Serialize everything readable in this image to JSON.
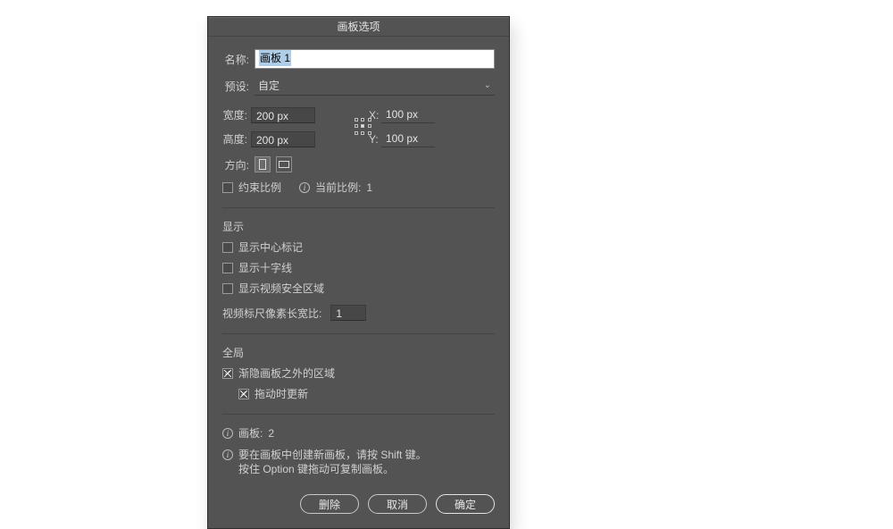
{
  "dialog": {
    "title": "画板选项",
    "name_label": "名称:",
    "name_value": "画板 1",
    "preset_label": "预设:",
    "preset_value": "自定",
    "width_label": "宽度:",
    "width_value": "200 px",
    "height_label": "高度:",
    "height_value": "200 px",
    "x_label": "X:",
    "x_value": "100 px",
    "y_label": "Y:",
    "y_value": "100 px",
    "orientation_label": "方向:",
    "constrain_label": "约束比例",
    "current_ratio_label": "当前比例:",
    "current_ratio_value": "1",
    "display_heading": "显示",
    "show_center_label": "显示中心标记",
    "show_crosshair_label": "显示十字线",
    "show_safe_label": "显示视频安全区域",
    "ruler_ratio_label": "视频标尺像素长宽比:",
    "ruler_ratio_value": "1",
    "global_heading": "全局",
    "fade_label": "渐隐画板之外的区域",
    "drag_update_label": "拖动时更新",
    "artboard_count_label": "画板:",
    "artboard_count_value": "2",
    "hint_line1": "要在画板中创建新画板，请按 Shift 键。",
    "hint_line2": "按住 Option 键拖动可复制画板。",
    "buttons": {
      "delete": "删除",
      "cancel": "取消",
      "ok": "确定"
    }
  }
}
